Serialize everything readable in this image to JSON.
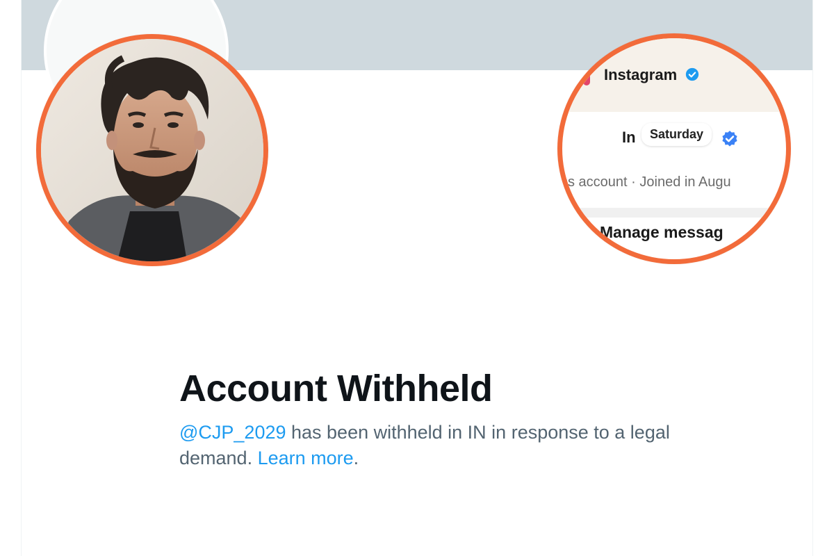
{
  "profile": {
    "handle": "@CJP_2029"
  },
  "instagram_callout": {
    "platform_label": "Instagram",
    "name_prefix": "In",
    "overlay_pill": "Saturday",
    "subtitle": "ss account · Joined in Augu",
    "manage_button": "Manage messag"
  },
  "notice": {
    "title": "Account Withheld",
    "message_body": " has been withheld in IN in response to a legal demand. ",
    "learn_more": "Learn more",
    "trailing": "."
  },
  "colors": {
    "highlight_ring": "#f26b3a",
    "link_blue": "#1d9bf0",
    "banner": "#cfd9de",
    "verified_blue": "#1d9bf0",
    "instagram_verified": "#3b82f6"
  },
  "icons": {
    "verified": "verified-badge-icon"
  }
}
